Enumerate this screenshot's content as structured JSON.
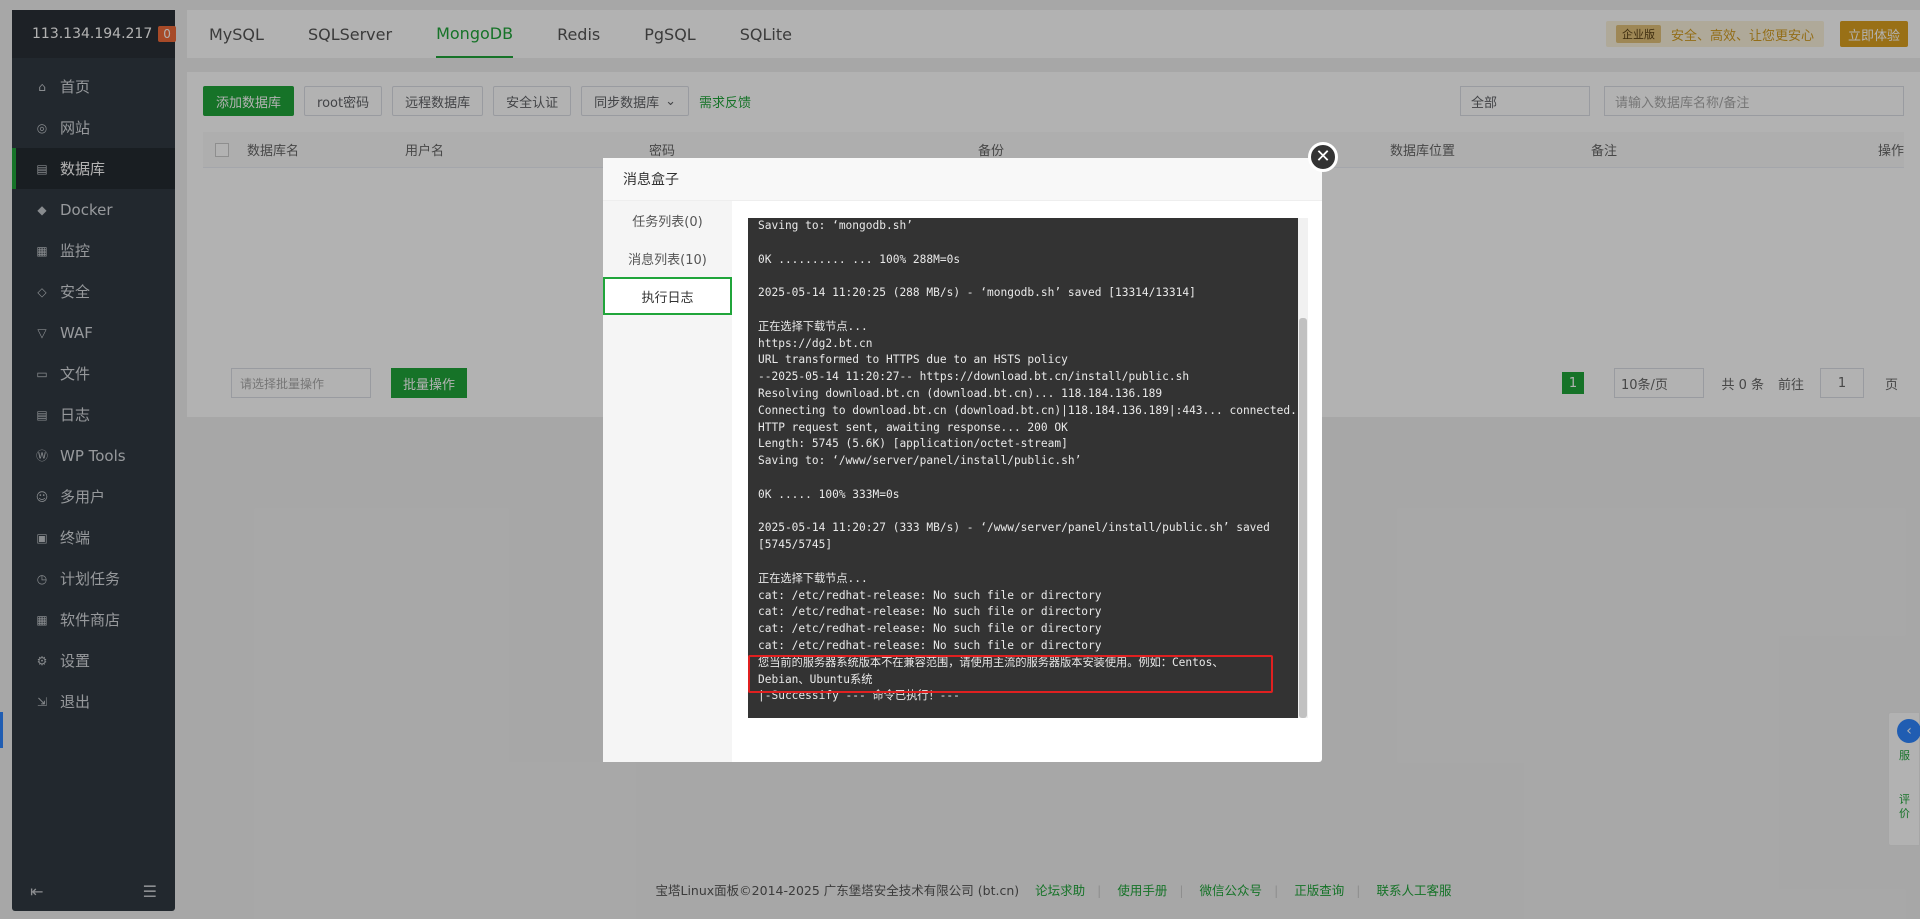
{
  "server": {
    "ip": "113.134.194.217",
    "badge": "0"
  },
  "sidebar": {
    "items": [
      {
        "label": "首页",
        "icon": "home-icon"
      },
      {
        "label": "网站",
        "icon": "globe-icon"
      },
      {
        "label": "数据库",
        "icon": "database-icon"
      },
      {
        "label": "Docker",
        "icon": "docker-icon"
      },
      {
        "label": "监控",
        "icon": "monitor-icon"
      },
      {
        "label": "安全",
        "icon": "shield-icon"
      },
      {
        "label": "WAF",
        "icon": "waf-icon"
      },
      {
        "label": "文件",
        "icon": "folder-icon"
      },
      {
        "label": "日志",
        "icon": "log-icon"
      },
      {
        "label": "WP Tools",
        "icon": "wordpress-icon"
      },
      {
        "label": "多用户",
        "icon": "users-icon"
      },
      {
        "label": "终端",
        "icon": "terminal-icon"
      },
      {
        "label": "计划任务",
        "icon": "clock-icon"
      },
      {
        "label": "软件商店",
        "icon": "apps-icon"
      },
      {
        "label": "设置",
        "icon": "gear-icon"
      },
      {
        "label": "退出",
        "icon": "logout-icon"
      }
    ],
    "active_index": 2
  },
  "tabs": [
    "MySQL",
    "SQLServer",
    "MongoDB",
    "Redis",
    "PgSQL",
    "SQLite"
  ],
  "active_tab": 2,
  "enterprise": {
    "badge": "企业版",
    "text": "安全、高效、让您更安心",
    "try_label": "立即体验"
  },
  "toolbar": {
    "add_db": "添加数据库",
    "root_pwd": "root密码",
    "remote_db": "远程数据库",
    "security": "安全认证",
    "sync_db": "同步数据库",
    "feedback": "需求反馈",
    "filter_all": "全部",
    "search_placeholder": "请输入数据库名称/备注"
  },
  "table": {
    "headers": [
      "数据库名",
      "用户名",
      "密码",
      "备份",
      "数据库位置",
      "备注",
      "操作"
    ]
  },
  "pager": {
    "batch_placeholder": "请选择批量操作",
    "batch_btn": "批量操作",
    "page": "1",
    "per_page": "10条/页",
    "total": "共 0 条",
    "goto": "前往",
    "goto_val": "1",
    "page_unit": "页"
  },
  "modal": {
    "title": "消息盒子",
    "side": [
      "任务列表(0)",
      "消息列表(10)",
      "执行日志"
    ],
    "active_side": 2,
    "log_lines": [
      "Saving to: ‘mongodb.sh’",
      "",
      "0K .......... ... 100% 288M=0s",
      "",
      "2025-05-14 11:20:25 (288 MB/s) - ‘mongodb.sh’ saved [13314/13314]",
      "",
      "正在选择下载节点...",
      "https://dg2.bt.cn",
      "URL transformed to HTTPS due to an HSTS policy",
      "--2025-05-14 11:20:27-- https://download.bt.cn/install/public.sh",
      "Resolving download.bt.cn (download.bt.cn)... 118.184.136.189",
      "Connecting to download.bt.cn (download.bt.cn)|118.184.136.189|:443... connected.",
      "HTTP request sent, awaiting response... 200 OK",
      "Length: 5745 (5.6K) [application/octet-stream]",
      "Saving to: ‘/www/server/panel/install/public.sh’",
      "",
      "0K ..... 100% 333M=0s",
      "",
      "2025-05-14 11:20:27 (333 MB/s) - ‘/www/server/panel/install/public.sh’ saved",
      "[5745/5745]",
      "",
      "正在选择下载节点...",
      "cat: /etc/redhat-release: No such file or directory",
      "cat: /etc/redhat-release: No such file or directory",
      "cat: /etc/redhat-release: No such file or directory",
      "cat: /etc/redhat-release: No such file or directory",
      "您当前的服务器系统版本不在兼容范围，请使用主流的服务器版本安装使用。例如：Centos、",
      "Debian、Ubuntu系统",
      "|-Successify --- 命令已执行！---"
    ]
  },
  "footer": {
    "copyright": "宝塔Linux面板©2014-2025 广东堡塔安全技术有限公司 (bt.cn)",
    "links": [
      "论坛求助",
      "使用手册",
      "微信公众号",
      "正版查询",
      "联系人工客服"
    ]
  },
  "rfloat": {
    "service": "服",
    "review": "评价"
  },
  "colors": {
    "brand": "#20a53a",
    "sidebar": "#313a42",
    "highlight": "#e02020"
  }
}
